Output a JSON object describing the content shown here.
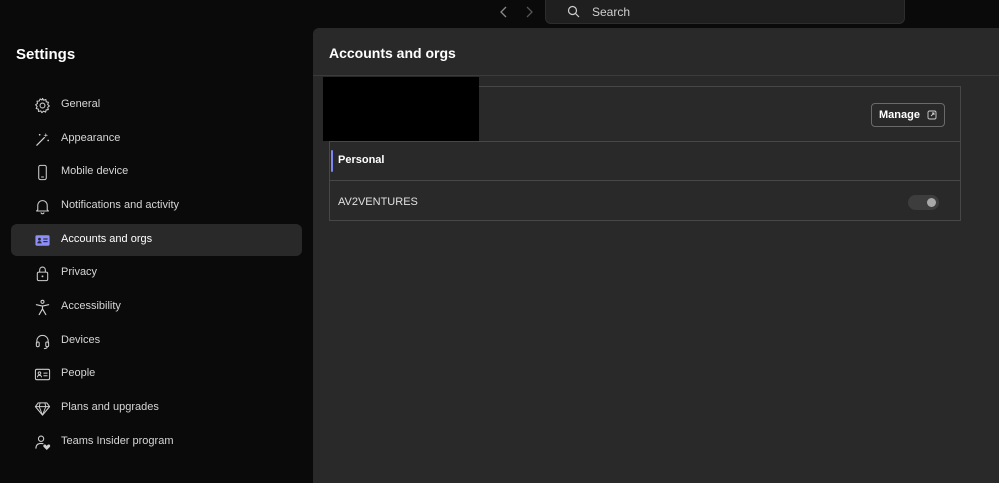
{
  "topbar": {
    "back_icon": "chevron-left-icon",
    "forward_icon": "chevron-right-icon",
    "search_placeholder": "Search",
    "search_icon": "search-icon"
  },
  "sidebar": {
    "title": "Settings",
    "items": [
      {
        "label": "General",
        "icon": "gear-icon",
        "active": false
      },
      {
        "label": "Appearance",
        "icon": "magic-wand-icon",
        "active": false
      },
      {
        "label": "Mobile device",
        "icon": "phone-icon",
        "active": false
      },
      {
        "label": "Notifications and activity",
        "icon": "bell-icon",
        "active": false
      },
      {
        "label": "Accounts and orgs",
        "icon": "id-card-icon",
        "active": true
      },
      {
        "label": "Privacy",
        "icon": "lock-icon",
        "active": false
      },
      {
        "label": "Accessibility",
        "icon": "accessibility-icon",
        "active": false
      },
      {
        "label": "Devices",
        "icon": "headset-icon",
        "active": false
      },
      {
        "label": "People",
        "icon": "contact-card-icon",
        "active": false
      },
      {
        "label": "Plans and upgrades",
        "icon": "diamond-icon",
        "active": false
      },
      {
        "label": "Teams Insider program",
        "icon": "person-heart-icon",
        "active": false
      }
    ]
  },
  "main": {
    "title": "Accounts and orgs",
    "manage_label": "Manage",
    "manage_icon": "open-external-icon",
    "personal_label": "Personal",
    "org_name": "AV2VENTURES",
    "org_toggle_on": false
  },
  "colors": {
    "background": "#0a0a0a",
    "panel": "#292929",
    "accent": "#7f85f5",
    "active_item": "#292929"
  }
}
